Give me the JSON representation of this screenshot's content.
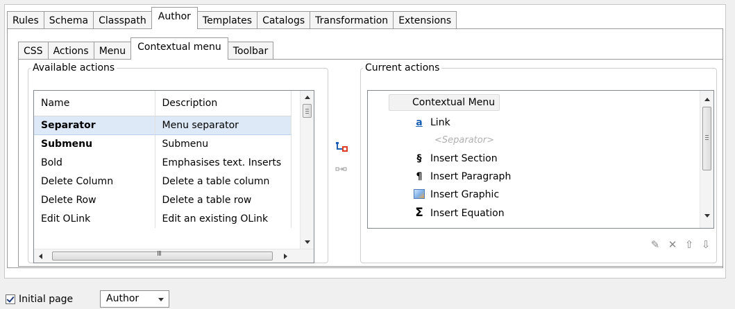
{
  "main_tabs": [
    "Rules",
    "Schema",
    "Classpath",
    "Author",
    "Templates",
    "Catalogs",
    "Transformation",
    "Extensions"
  ],
  "main_active_tab": "Author",
  "sub_tabs": [
    "CSS",
    "Actions",
    "Menu",
    "Contextual menu",
    "Toolbar"
  ],
  "sub_active_tab": "Contextual menu",
  "available": {
    "legend": "Available actions",
    "columns": [
      "Name",
      "Description"
    ],
    "rows": [
      {
        "name": "Separator",
        "description": "Menu separator",
        "bold": true,
        "selected": true
      },
      {
        "name": "Submenu",
        "description": "Submenu",
        "bold": true,
        "selected": false
      },
      {
        "name": "Bold",
        "description": "Emphasises text. Inserts",
        "bold": false,
        "selected": false
      },
      {
        "name": "Delete Column",
        "description": "Delete a table column",
        "bold": false,
        "selected": false
      },
      {
        "name": "Delete Row",
        "description": "Delete a table row",
        "bold": false,
        "selected": false
      },
      {
        "name": "Edit OLink",
        "description": "Edit an existing OLink",
        "bold": false,
        "selected": false
      }
    ]
  },
  "current": {
    "legend": "Current actions",
    "root": "Contextual Menu",
    "items": [
      {
        "icon": "link-icon",
        "glyph": "a",
        "label": "Link"
      },
      {
        "icon": "",
        "glyph": "",
        "label": "<Separator>"
      },
      {
        "icon": "section-icon",
        "glyph": "§",
        "label": "Insert Section"
      },
      {
        "icon": "paragraph-icon",
        "glyph": "¶",
        "label": "Insert Paragraph"
      },
      {
        "icon": "graphic-icon",
        "glyph": "",
        "label": "Insert Graphic"
      },
      {
        "icon": "equation-icon",
        "glyph": "Σ",
        "label": "Insert Equation"
      }
    ]
  },
  "bottom": {
    "initial_page_label": "Initial page",
    "initial_page_checked": true,
    "initial_page_value": "Author"
  },
  "colors": {
    "selection": "#dde9f7",
    "link_icon": "#1a5fb4",
    "add_icon": "#e03b24"
  }
}
